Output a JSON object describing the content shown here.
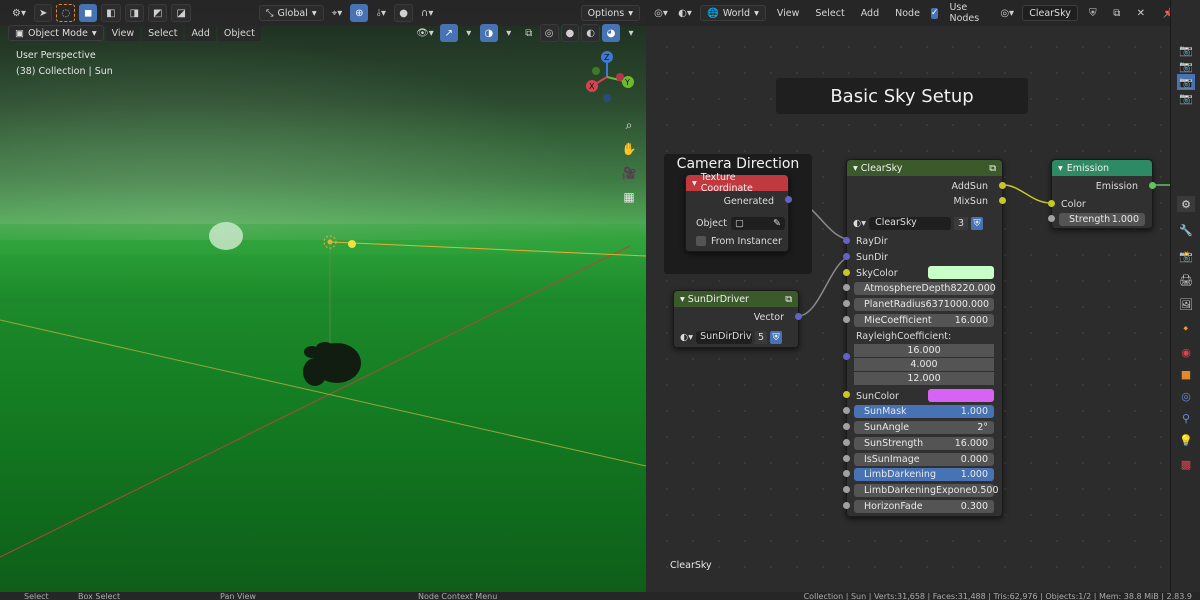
{
  "viewport": {
    "header": {
      "transform_orientation": "Global",
      "options_label": "Options"
    },
    "menus": {
      "mode": "Object Mode",
      "view": "View",
      "select": "Select",
      "add": "Add",
      "object": "Object"
    },
    "overlay": {
      "perspective": "User Perspective",
      "collection": "(38) Collection | Sun"
    },
    "gizmo": {
      "z": "Z",
      "y": "Y",
      "x": "X"
    }
  },
  "node_editor": {
    "header": {
      "shader_type": "World",
      "view": "View",
      "select": "Select",
      "add": "Add",
      "node": "Node",
      "use_nodes": "Use Nodes",
      "datablock": "ClearSky"
    },
    "frames": {
      "title": "Basic Sky Setup",
      "camera": "Camera Direction"
    },
    "texture_coordinate": {
      "title": "Texture Coordinate",
      "output": "Generated",
      "object_label": "Object",
      "from_instancer": "From Instancer"
    },
    "sundir_driver": {
      "title": "SunDirDriver",
      "output": "Vector",
      "group_name": "SunDirDrive",
      "users": "5"
    },
    "clearsky": {
      "title": "ClearSky",
      "out_addsun": "AddSun",
      "out_mixsun": "MixSun",
      "group_name": "ClearSky",
      "users": "3",
      "in_raydir": "RayDir",
      "in_sundir": "SunDir",
      "in_skycolor": "SkyColor",
      "sky_color_swatch": "#c8ffc8",
      "atmosphere_depth_label": "AtmosphereDepth",
      "atmosphere_depth": "8220.000",
      "planet_radius_label": "PlanetRadius",
      "planet_radius": "6371000.000",
      "mie_label": "MieCoefficient",
      "mie": "16.000",
      "rayleigh_label": "RayleighCoefficient:",
      "rayleigh": [
        "16.000",
        "4.000",
        "12.000"
      ],
      "in_suncolor": "SunColor",
      "sun_color_swatch": "#d763f5",
      "sunmask_label": "SunMask",
      "sunmask": "1.000",
      "sunangle_label": "SunAngle",
      "sunangle": "2°",
      "sunstrength_label": "SunStrength",
      "sunstrength": "16.000",
      "issunimage_label": "IsSunImage",
      "issunimage": "0.000",
      "limb_label": "LimbDarkening",
      "limb": "1.000",
      "limb_exp_label": "LimbDarkeningExpone",
      "limb_exp": "0.500",
      "horizon_label": "HorizonFade",
      "horizon": "0.300"
    },
    "emission": {
      "title": "Emission",
      "output": "Emission",
      "in_color": "Color",
      "strength_label": "Strength",
      "strength": "1.000"
    },
    "footer_label": "ClearSky"
  },
  "status": {
    "select": "Select",
    "box_select": "Box Select",
    "pan_view": "Pan View",
    "context_menu": "Node Context Menu",
    "stats": "Collection | Sun | Verts:31,658 | Faces:31,488 | Tris:62,976 | Objects:1/2 | Mem: 38.8 MiB | 2.83.9"
  },
  "colors": {
    "node_group_header": "#3b5a2b",
    "texcoord_header": "#c0393f",
    "emission_header": "#2e8a62",
    "accent": "#4772b3"
  }
}
